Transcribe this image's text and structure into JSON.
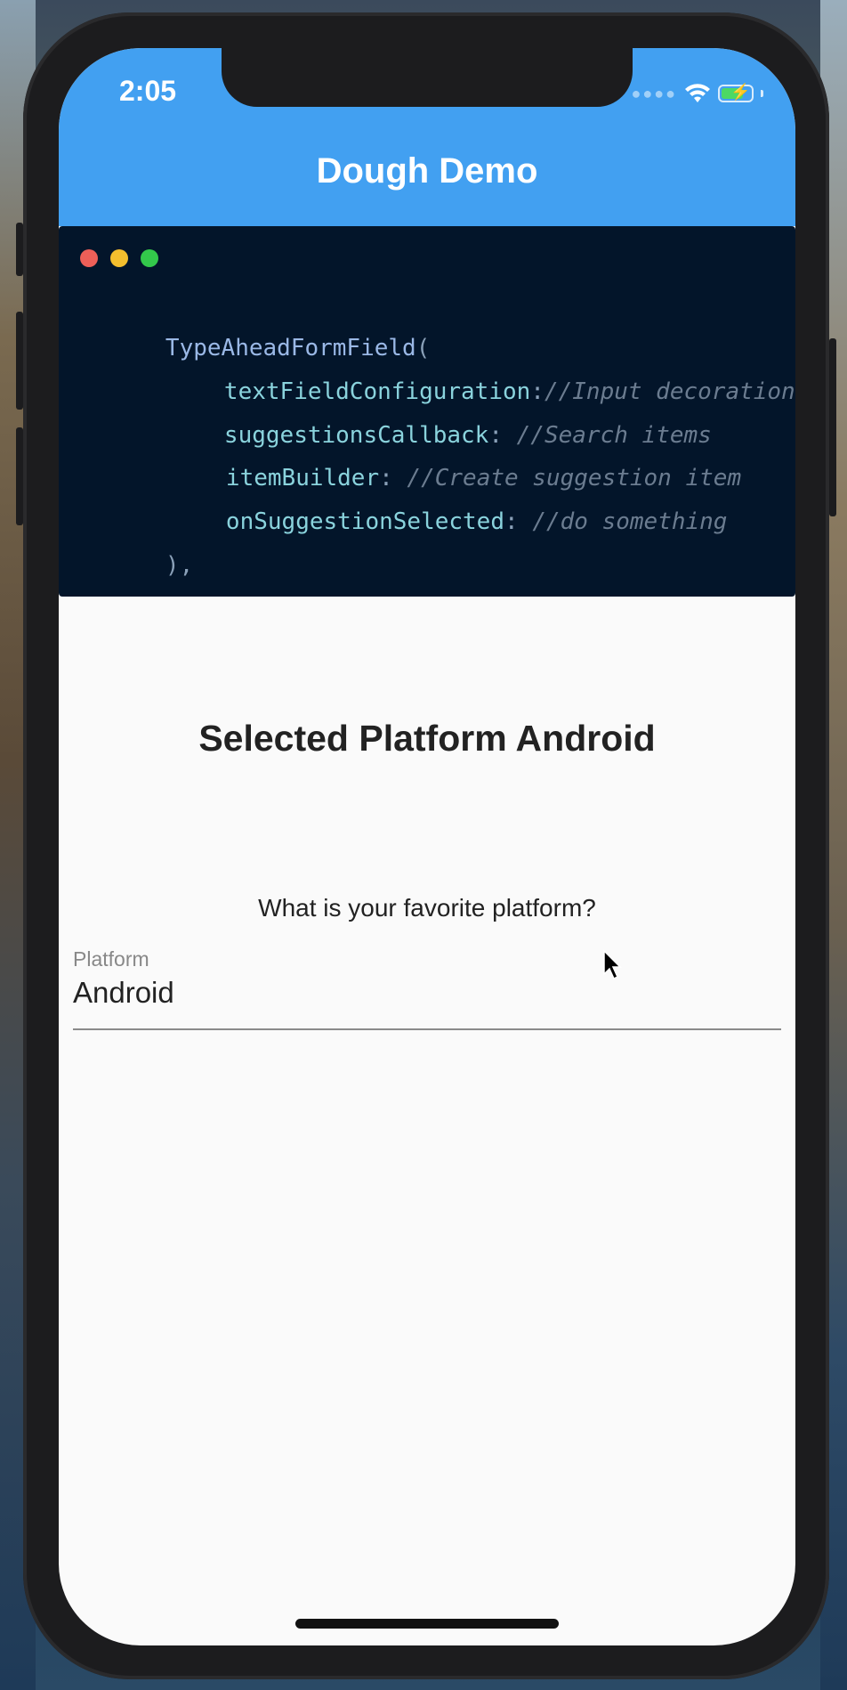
{
  "status_bar": {
    "time": "2:05",
    "signal_icon": "cellular-dots-icon",
    "wifi_icon": "wifi-icon",
    "battery_icon": "battery-charging-icon",
    "battery_level": 0.75
  },
  "app_bar": {
    "title": "Dough Demo",
    "color": "#42a0f1"
  },
  "code_window": {
    "dots": [
      {
        "name": "close",
        "color": "#ee5f58"
      },
      {
        "name": "minimize",
        "color": "#f4bf2e"
      },
      {
        "name": "maximize",
        "color": "#33c84b"
      }
    ],
    "lines": {
      "l1_ident": "TypeAheadFormField",
      "l1_punct": "(",
      "l2_ident": "textFieldConfiguration",
      "l2_punct": ":",
      "l2_comment": "//Input decoration",
      "l3_ident": "suggestionsCallback",
      "l3_punct": ": ",
      "l3_comment": "//Search items",
      "l4_ident": "itemBuilder",
      "l4_punct": ": ",
      "l4_comment": "//Create suggestion item",
      "l5_ident": "onSuggestionSelected",
      "l5_punct": ": ",
      "l5_comment": "//do something",
      "l6_punct": "),"
    }
  },
  "content": {
    "selected_heading": "Selected Platform Android",
    "question": "What is your favorite platform?",
    "field": {
      "label": "Platform",
      "value": "Android"
    }
  },
  "colors": {
    "code_background": "#03152a",
    "page_background": "#fafafa"
  }
}
